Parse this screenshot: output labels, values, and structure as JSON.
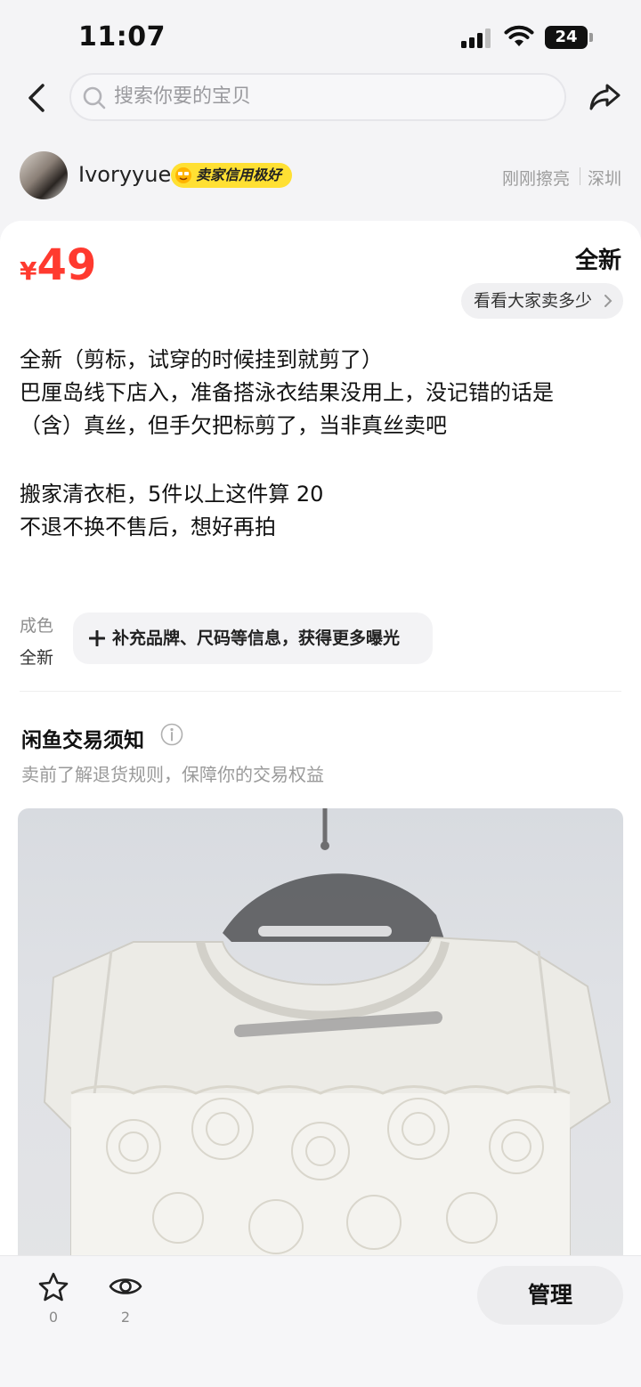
{
  "status_bar": {
    "time": "11:07",
    "battery": "24",
    "icons": [
      "signal-icon",
      "wifi-icon",
      "battery-icon"
    ]
  },
  "header": {
    "search_placeholder": "搜索你要的宝贝",
    "icons": [
      "back-icon",
      "search-icon",
      "share-icon"
    ]
  },
  "seller": {
    "name": "Ivoryyue",
    "credit_badge": "卖家信用极好",
    "post_time": "刚刚擦亮",
    "location": "深圳"
  },
  "item": {
    "price_currency": "¥",
    "price": "49",
    "condition_tag": "全新",
    "compare_label": "看看大家卖多少",
    "description": [
      "全新（剪标，试穿的时候挂到就剪了）",
      "巴厘岛线下店入，准备搭泳衣结果没用上，没记错的话是",
      "（含）真丝，但手欠把标剪了，当非真丝卖吧",
      "",
      "搬家清衣柜，5件以上这件算 20",
      "不退不换不售后，想好再拍"
    ],
    "condition_label": "成色",
    "condition_value": "全新",
    "supplement_label": "补充品牌、尺码等信息，获得更多曝光"
  },
  "notice": {
    "title": "闲鱼交易须知",
    "subtitle": "卖前了解退货规则，保障你的交易权益"
  },
  "bottom_bar": {
    "favorite_count": "0",
    "view_count": "2",
    "manage_label": "管理"
  },
  "colors": {
    "price": "#ff3a2f",
    "accent_yellow": "#ffe033",
    "background": "#f4f4f6"
  }
}
